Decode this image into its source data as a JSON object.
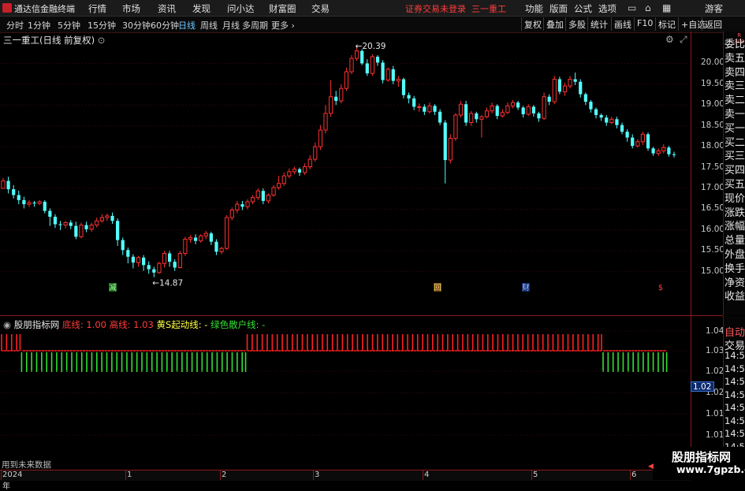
{
  "topbar": {
    "app_name": "通达信金融终端",
    "menus": [
      "行情",
      "市场",
      "资讯",
      "发现",
      "问小达",
      "财富圈",
      "交易"
    ],
    "warning": "证券交易未登录",
    "stock_name": "三一重工",
    "right_menus": [
      "功能",
      "版面",
      "公式",
      "选项"
    ],
    "guest": "游客"
  },
  "toolbar": {
    "periods": [
      "分时",
      "1分钟",
      "5分钟",
      "15分钟",
      "30分钟",
      "60分钟",
      "日线",
      "周线",
      "月线",
      "多周期",
      "更多"
    ],
    "active_period": "日线",
    "buttons": [
      "复权",
      "叠加",
      "多股",
      "统计",
      "画线",
      "F10",
      "标记",
      "+自选",
      "返回"
    ]
  },
  "main_chart": {
    "title": "三一重工(日线 前复权)",
    "high_label": "20.39",
    "low_label": "14.87",
    "y_ticks": [
      "20.00",
      "19.50",
      "19.00",
      "18.50",
      "18.00",
      "17.50",
      "17.00",
      "16.50",
      "16.00",
      "15.50",
      "15.00"
    ],
    "markers": [
      "减",
      "回",
      "财",
      "$"
    ]
  },
  "indicator": {
    "name": "股朋指标网",
    "bottom_line_label": "底线: 1.00",
    "top_line_label": "高线: 1.03",
    "s_line_label": "黄S起动线: -",
    "green_line_label": "绿色散户线: -",
    "y_ticks": [
      "1.04",
      "1.03",
      "1.02",
      "1.02",
      "1.01",
      "1.01"
    ],
    "current_value": "1.02",
    "footer_text": "用到未来数据"
  },
  "sidebar_top": [
    "委比",
    "卖五",
    "卖四",
    "卖三",
    "卖二",
    "卖一",
    "买一",
    "买二",
    "买三",
    "买四",
    "买五",
    "现价",
    "涨跌",
    "涨幅",
    "总量",
    "外盘",
    "换手",
    "净资",
    "收益"
  ],
  "sidebar_top_badge": "R\n300",
  "sidebar_bottom": [
    "自动",
    "交易",
    "14:56",
    "14:56",
    "14:56",
    "14:56",
    "14:56",
    "14:56",
    "14:56",
    "14:56",
    "14:56",
    "14:56"
  ],
  "date_axis": [
    "2024年",
    "1",
    "2",
    "3",
    "4",
    "5",
    "6"
  ],
  "watermark": {
    "line1": "股朋指标网",
    "line2": "www.7gpzb.com"
  },
  "colors": {
    "up": "#ff3232",
    "down": "#54ffff",
    "red_bar": "#ff2020",
    "green_bar": "#33e033",
    "grid": "#8b1a1a"
  },
  "chart_data": {
    "type": "candlestick",
    "title": "三一重工(日线 前复权)",
    "ylim": [
      14.75,
      20.5
    ],
    "candles": [
      [
        17.0,
        17.18,
        17.06,
        17.25
      ],
      [
        17.18,
        16.98,
        16.88,
        17.28
      ],
      [
        16.98,
        16.84,
        16.76,
        17.08
      ],
      [
        16.84,
        16.72,
        16.62,
        16.95
      ],
      [
        16.72,
        16.62,
        16.52,
        16.8
      ],
      [
        16.62,
        16.66,
        16.55,
        16.72
      ],
      [
        16.66,
        16.64,
        16.56,
        16.7
      ],
      [
        16.64,
        16.68,
        16.6,
        16.72
      ],
      [
        16.68,
        16.46,
        16.4,
        16.72
      ],
      [
        16.46,
        16.32,
        16.1,
        16.52
      ],
      [
        16.32,
        16.14,
        16.05,
        16.38
      ],
      [
        16.14,
        16.12,
        16.0,
        16.22
      ],
      [
        16.12,
        16.18,
        16.04,
        16.22
      ],
      [
        16.18,
        16.1,
        16.02,
        16.24
      ],
      [
        16.1,
        15.84,
        15.78,
        16.2
      ],
      [
        15.84,
        16.12,
        15.8,
        16.18
      ],
      [
        16.12,
        16.02,
        15.95,
        16.2
      ],
      [
        16.02,
        16.12,
        15.96,
        16.18
      ],
      [
        16.12,
        16.22,
        16.06,
        16.3
      ],
      [
        16.22,
        16.3,
        16.18,
        16.38
      ],
      [
        16.3,
        16.34,
        16.22,
        16.4
      ],
      [
        16.34,
        16.22,
        16.15,
        16.42
      ],
      [
        16.22,
        15.76,
        15.62,
        16.28
      ],
      [
        15.76,
        15.52,
        15.4,
        15.82
      ],
      [
        15.52,
        15.36,
        15.2,
        15.58
      ],
      [
        15.36,
        15.22,
        15.08,
        15.42
      ],
      [
        15.22,
        15.34,
        15.12,
        15.38
      ],
      [
        15.34,
        15.16,
        15.02,
        15.4
      ],
      [
        15.16,
        15.06,
        14.95,
        15.25
      ],
      [
        15.06,
        14.98,
        14.87,
        15.12
      ],
      [
        14.98,
        15.2,
        14.95,
        15.24
      ],
      [
        15.2,
        15.44,
        15.1,
        15.5
      ],
      [
        15.44,
        15.24,
        15.12,
        15.5
      ],
      [
        15.24,
        15.1,
        15.02,
        15.3
      ],
      [
        15.1,
        15.44,
        15.08,
        15.5
      ],
      [
        15.44,
        15.78,
        15.38,
        15.84
      ],
      [
        15.78,
        15.82,
        15.7,
        15.88
      ],
      [
        15.82,
        15.74,
        15.66,
        15.9
      ],
      [
        15.74,
        15.86,
        15.7,
        15.9
      ],
      [
        15.86,
        15.92,
        15.78,
        15.98
      ],
      [
        15.92,
        15.72,
        15.64,
        15.96
      ],
      [
        15.72,
        15.48,
        15.4,
        15.78
      ],
      [
        15.48,
        15.56,
        15.42,
        15.6
      ],
      [
        15.56,
        16.3,
        15.52,
        16.36
      ],
      [
        16.3,
        16.48,
        16.24,
        16.54
      ],
      [
        16.48,
        16.62,
        16.4,
        16.7
      ],
      [
        16.62,
        16.56,
        16.48,
        16.7
      ],
      [
        16.56,
        16.68,
        16.5,
        16.74
      ],
      [
        16.68,
        16.78,
        16.62,
        16.84
      ],
      [
        16.78,
        16.94,
        16.72,
        17.0
      ],
      [
        16.94,
        16.7,
        16.62,
        17.0
      ],
      [
        16.7,
        16.84,
        16.64,
        16.88
      ],
      [
        16.84,
        17.02,
        16.8,
        17.08
      ],
      [
        17.02,
        17.12,
        16.96,
        17.3
      ],
      [
        17.12,
        17.3,
        17.06,
        17.38
      ],
      [
        17.3,
        17.4,
        17.24,
        17.48
      ],
      [
        17.4,
        17.46,
        17.34,
        17.52
      ],
      [
        17.46,
        17.38,
        17.3,
        17.5
      ],
      [
        17.38,
        17.52,
        17.32,
        17.6
      ],
      [
        17.52,
        17.7,
        17.46,
        17.8
      ],
      [
        17.7,
        18.0,
        17.64,
        18.1
      ],
      [
        18.0,
        18.4,
        17.92,
        18.52
      ],
      [
        18.4,
        18.8,
        18.32,
        19.0
      ],
      [
        18.8,
        19.2,
        18.72,
        19.6
      ],
      [
        19.2,
        19.1,
        19.0,
        19.34
      ],
      [
        19.1,
        19.4,
        19.04,
        19.5
      ],
      [
        19.4,
        19.8,
        19.34,
        19.9
      ],
      [
        19.8,
        20.12,
        19.74,
        20.2
      ],
      [
        20.12,
        20.3,
        20.06,
        20.39
      ],
      [
        20.3,
        20.0,
        19.96,
        20.34
      ],
      [
        20.0,
        19.76,
        19.7,
        20.1
      ],
      [
        19.76,
        20.16,
        19.7,
        20.22
      ],
      [
        20.16,
        20.02,
        19.94,
        20.2
      ],
      [
        20.02,
        19.6,
        19.52,
        20.08
      ],
      [
        19.6,
        19.86,
        19.56,
        19.9
      ],
      [
        19.86,
        19.58,
        19.5,
        19.94
      ],
      [
        19.58,
        19.62,
        19.44,
        19.7
      ],
      [
        19.62,
        19.24,
        19.16,
        19.66
      ],
      [
        19.24,
        19.16,
        19.04,
        19.3
      ],
      [
        19.16,
        18.96,
        18.88,
        19.22
      ],
      [
        18.96,
        18.96,
        18.84,
        19.04
      ],
      [
        18.96,
        18.84,
        18.76,
        19.02
      ],
      [
        18.84,
        18.98,
        18.8,
        19.06
      ],
      [
        18.98,
        18.84,
        18.76,
        19.02
      ],
      [
        18.84,
        18.58,
        18.52,
        18.9
      ],
      [
        18.58,
        17.68,
        17.12,
        18.64
      ],
      [
        17.68,
        18.2,
        17.6,
        18.3
      ],
      [
        18.2,
        18.76,
        18.14,
        18.8
      ],
      [
        18.76,
        19.02,
        18.7,
        19.1
      ],
      [
        19.02,
        18.58,
        18.5,
        19.1
      ],
      [
        18.58,
        18.8,
        18.5,
        18.86
      ],
      [
        18.8,
        18.66,
        18.58,
        18.84
      ],
      [
        18.66,
        18.72,
        18.22,
        18.76
      ],
      [
        18.72,
        18.86,
        18.68,
        18.94
      ],
      [
        18.86,
        18.98,
        18.8,
        19.06
      ],
      [
        18.98,
        18.74,
        18.66,
        19.02
      ],
      [
        18.74,
        18.82,
        18.7,
        18.9
      ],
      [
        18.82,
        18.98,
        18.78,
        19.06
      ],
      [
        18.98,
        19.06,
        18.92,
        19.12
      ],
      [
        19.06,
        18.94,
        18.88,
        19.1
      ],
      [
        18.94,
        18.78,
        18.7,
        18.98
      ],
      [
        18.78,
        18.96,
        18.74,
        19.02
      ],
      [
        18.96,
        18.8,
        18.72,
        19.0
      ],
      [
        18.8,
        18.68,
        18.6,
        18.84
      ],
      [
        18.68,
        19.2,
        18.64,
        19.3
      ],
      [
        19.2,
        19.08,
        19.0,
        19.26
      ],
      [
        19.08,
        19.62,
        19.02,
        19.7
      ],
      [
        19.62,
        19.32,
        19.26,
        19.68
      ],
      [
        19.32,
        19.46,
        19.22,
        19.54
      ],
      [
        19.46,
        19.62,
        19.4,
        19.7
      ],
      [
        19.62,
        19.56,
        19.48,
        19.78
      ],
      [
        19.56,
        19.26,
        19.18,
        19.62
      ],
      [
        19.26,
        19.08,
        19.0,
        19.3
      ],
      [
        19.08,
        18.9,
        18.82,
        19.12
      ],
      [
        18.9,
        18.76,
        18.68,
        18.94
      ],
      [
        18.76,
        18.7,
        18.62,
        18.8
      ],
      [
        18.7,
        18.58,
        18.5,
        18.76
      ],
      [
        18.58,
        18.66,
        18.54,
        18.72
      ],
      [
        18.66,
        18.52,
        18.44,
        18.72
      ],
      [
        18.52,
        18.36,
        18.3,
        18.58
      ],
      [
        18.36,
        18.22,
        18.12,
        18.42
      ],
      [
        18.22,
        18.02,
        17.96,
        18.3
      ],
      [
        18.02,
        18.12,
        17.98,
        18.18
      ],
      [
        18.12,
        18.3,
        18.04,
        18.36
      ],
      [
        18.3,
        17.96,
        17.9,
        18.34
      ],
      [
        17.96,
        17.84,
        17.78,
        18.0
      ],
      [
        17.84,
        17.9,
        17.78,
        17.96
      ],
      [
        17.9,
        17.98,
        17.84,
        18.06
      ],
      [
        17.98,
        17.82,
        17.76,
        18.02
      ],
      [
        17.82,
        17.8,
        17.74,
        17.88
      ]
    ],
    "indicator_blocks": [
      {
        "type": "red",
        "from": 0,
        "to": 3
      },
      {
        "type": "green",
        "from": 4,
        "to": 48
      },
      {
        "type": "red",
        "from": 49,
        "to": 119
      },
      {
        "type": "green",
        "from": 120,
        "to": 132
      }
    ]
  }
}
